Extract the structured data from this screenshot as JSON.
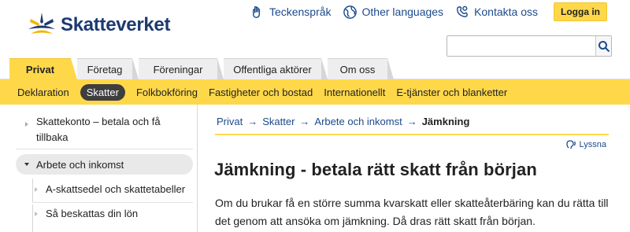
{
  "header": {
    "logo_text": "Skatteverket",
    "links": [
      {
        "label": "Teckenspråk",
        "icon": "sign-language-icon"
      },
      {
        "label": "Other languages",
        "icon": "globe-icon"
      },
      {
        "label": "Kontakta oss",
        "icon": "contact-icon"
      }
    ],
    "login_label": "Logga in",
    "search": {
      "placeholder": "",
      "value": ""
    }
  },
  "tabs": [
    "Privat",
    "Företag",
    "Föreningar",
    "Offentliga aktörer",
    "Om oss"
  ],
  "subnav": [
    "Deklaration",
    "Skatter",
    "Folkbokföring",
    "Fastigheter och bostad",
    "Internationellt",
    "E-tjänster och blanketter"
  ],
  "sidenav": {
    "item_skattekonto": "Skattekonto – betala och få tillbaka",
    "item_arbete": "Arbete och inkomst",
    "sub_items": [
      "A-skattsedel och skattetabeller",
      "Så beskattas din lön"
    ]
  },
  "breadcrumb": {
    "items": [
      "Privat",
      "Skatter",
      "Arbete och inkomst"
    ],
    "current": "Jämkning"
  },
  "listen_label": "Lyssna",
  "main": {
    "title": "Jämkning - betala rätt skatt från början",
    "lead": "Om du brukar få en större summa kvarskatt eller skatteåterbäring kan du rätta till det genom att ansöka om jämkning. Då dras rätt skatt från början."
  },
  "colors": {
    "accent_yellow": "#ffd84a",
    "link_blue": "#1b4a8c",
    "logo_blue": "#1c3a70"
  }
}
